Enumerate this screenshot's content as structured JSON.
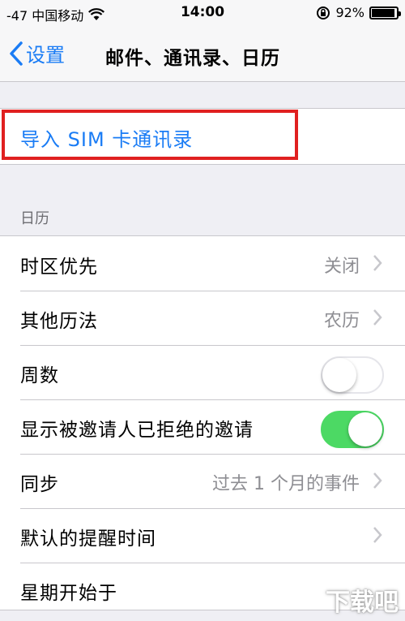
{
  "status_bar": {
    "carrier": "-47 中国移动",
    "time": "14:00",
    "battery_percent_text": "92%",
    "battery_level": 0.92
  },
  "nav": {
    "back_label": "设置",
    "title": "邮件、通讯录、日历"
  },
  "import_sim": {
    "label": "导入 SIM 卡通讯录"
  },
  "calendar_section": {
    "header": "日历",
    "rows": [
      {
        "label": "时区优先",
        "value": "关闭"
      },
      {
        "label": "其他历法",
        "value": "农历"
      },
      {
        "label": "周数",
        "toggle": "off"
      },
      {
        "label": "显示被邀请人已拒绝的邀请",
        "toggle": "on"
      },
      {
        "label": "同步",
        "value": "过去 1 个月的事件"
      },
      {
        "label": "默认的提醒时间",
        "value": ""
      },
      {
        "label": "星期开始于",
        "value": ""
      }
    ]
  },
  "watermark": "下载吧",
  "colors": {
    "accent": "#1a7cf5",
    "toggle_on": "#4cd964",
    "highlight": "#e02020"
  }
}
